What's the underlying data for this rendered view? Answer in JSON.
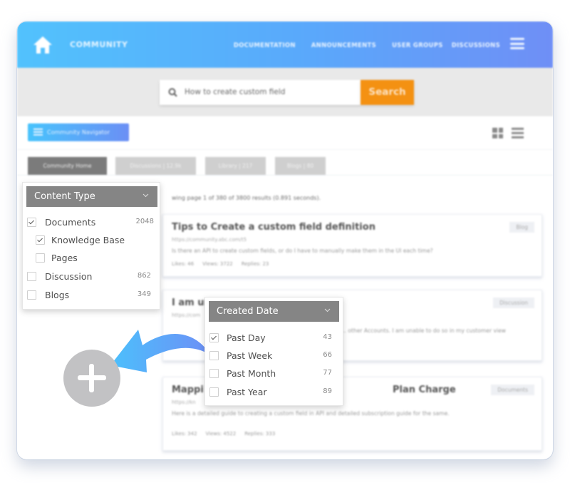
{
  "nav": {
    "brand": "COMMUNITY",
    "links": [
      "DOCUMENTATION",
      "ANNOUNCEMENTS",
      "USER GROUPS",
      "DISCUSSIONS"
    ],
    "gradient_start": "#52c2fd",
    "gradient_end": "#6f8ff6"
  },
  "search": {
    "value": "How to create custom field",
    "button_label": "Search",
    "button_color": "#f49112"
  },
  "toolbar": {
    "navigator_label": "Community Navigator",
    "view_icons": [
      "grid-view-icon",
      "list-view-icon"
    ]
  },
  "tabs": [
    {
      "label": "Community Home",
      "active": true
    },
    {
      "label": "Discussions | 12.9k",
      "active": false
    },
    {
      "label": "Library | 217",
      "active": false
    },
    {
      "label": "Blogs | 80",
      "active": false
    }
  ],
  "results": {
    "info": "wing page 1 of 380 of 3800 results (0.891 seconds).",
    "items": [
      {
        "title": "Tips to Create a custom field definition",
        "url": "https://community.abc.com/t5",
        "description": "Is there an API to create custom fields, or do I have to manually make them in the UI each time?",
        "likes": "Likes: 46",
        "views": "Views: 3722",
        "replies": "Replies: 23",
        "badge": "Blog"
      },
      {
        "title": "I am unable to",
        "url": "https://com",
        "description": "Is it possible ... other Accounts. I am unable to do so in my customer view",
        "badge": "Discussion"
      },
      {
        "title": "Mapping ... Plan Charge",
        "title_left": "Mappi",
        "title_right": "Plan Charge",
        "url": "https://kn",
        "description": "Here is a detailed guide to creating a custom field in API and detailed subscription guide for the same.",
        "likes": "Likes: 342",
        "views": "Views: 4522",
        "replies": "Replies: 333",
        "badge": "Documents"
      }
    ]
  },
  "content_type_filter": {
    "title": "Content Type",
    "items": [
      {
        "label": "Documents",
        "count": "2048",
        "checked": true
      },
      {
        "label": "Knowledge Base",
        "count": "",
        "checked": true
      },
      {
        "label": "Pages",
        "count": "",
        "checked": false
      },
      {
        "label": "Discussion",
        "count": "862",
        "checked": false
      },
      {
        "label": "Blogs",
        "count": "349",
        "checked": false
      }
    ]
  },
  "created_date_filter": {
    "title": "Created Date",
    "items": [
      {
        "label": "Past Day",
        "count": "43",
        "checked": true
      },
      {
        "label": "Past Week",
        "count": "66",
        "checked": false
      },
      {
        "label": "Past Month",
        "count": "77",
        "checked": false
      },
      {
        "label": "Past Year",
        "count": "89",
        "checked": false
      }
    ]
  },
  "overlay": {
    "add_button": "add-filter",
    "arrow_color_start": "#4cc0fc",
    "arrow_color_end": "#6d8ff6"
  }
}
